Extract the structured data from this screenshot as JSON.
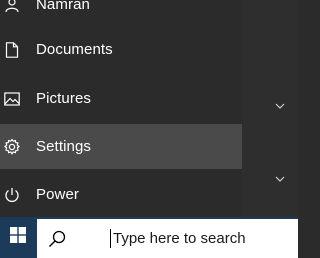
{
  "start_menu": {
    "user_name": "Namran",
    "items": [
      {
        "label": "Documents",
        "icon": "document-icon"
      },
      {
        "label": "Pictures",
        "icon": "pictures-icon"
      },
      {
        "label": "Settings",
        "icon": "gear-icon"
      },
      {
        "label": "Power",
        "icon": "power-icon"
      }
    ],
    "highlighted_item": "Settings"
  },
  "taskbar": {
    "start_button_icon": "windows-logo-icon",
    "search": {
      "placeholder": "Type here to search",
      "value": ""
    }
  },
  "colors": {
    "menu_bg": "#2b2b2b",
    "hover_bg": "#4a4a4a",
    "taskbar_bg": "#1c3a5a",
    "text": "#ffffff"
  }
}
